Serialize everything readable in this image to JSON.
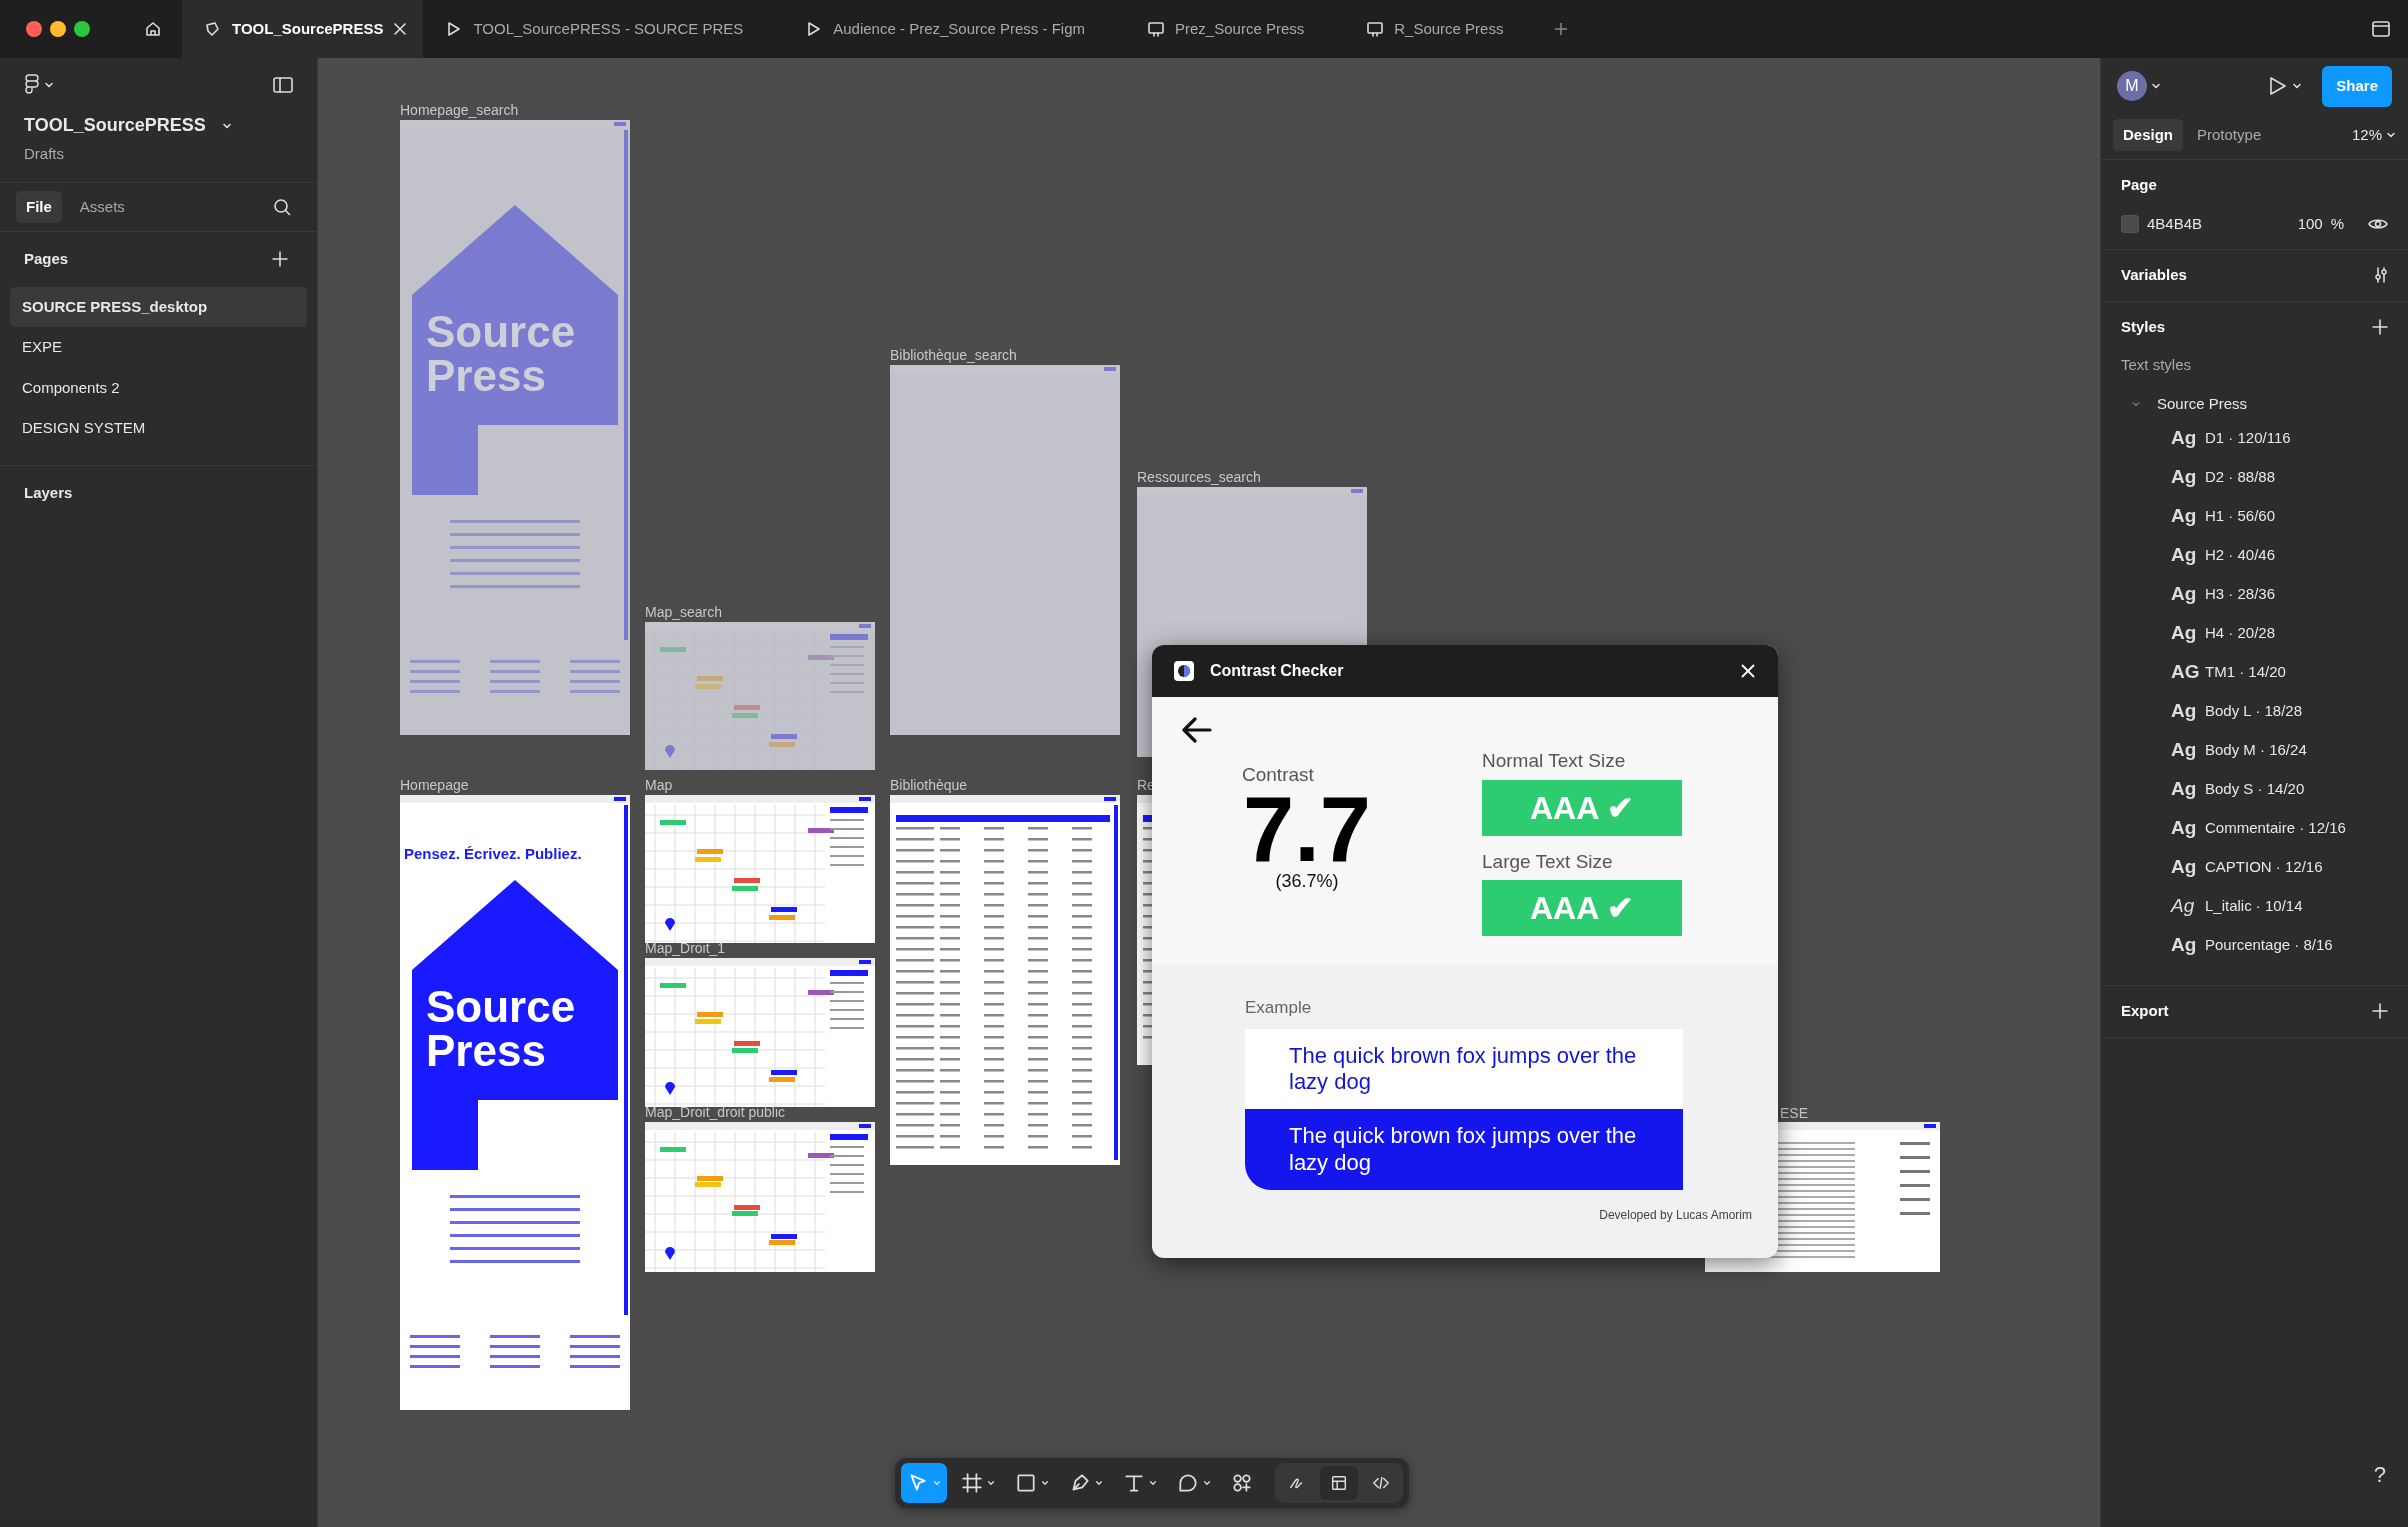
{
  "browser_tabs": [
    {
      "label": "TOOL_SourcePRESS",
      "kind": "design",
      "selected": true
    },
    {
      "label": "TOOL_SourcePRESS - SOURCE PRES",
      "kind": "prototype",
      "selected": false
    },
    {
      "label": "Audience - Prez_Source Press - Figm",
      "kind": "prototype",
      "selected": false
    },
    {
      "label": "Prez_Source Press",
      "kind": "slides",
      "selected": false
    },
    {
      "label": "R_Source Press",
      "kind": "slides",
      "selected": false
    }
  ],
  "sidebar": {
    "file_name": "TOOL_SourcePRESS",
    "location": "Drafts",
    "tabs": [
      {
        "label": "File",
        "selected": true
      },
      {
        "label": "Assets",
        "selected": false
      }
    ],
    "pages_heading": "Pages",
    "pages": [
      {
        "label": "SOURCE PRESS_desktop",
        "selected": true
      },
      {
        "label": "EXPE",
        "selected": false
      },
      {
        "label": "Components 2",
        "selected": false
      },
      {
        "label": "DESIGN SYSTEM",
        "selected": false
      }
    ],
    "layers_heading": "Layers"
  },
  "canvas": {
    "frames": [
      {
        "label": "Homepage_search",
        "kind": "home",
        "dimmed": true,
        "title": "Source Press"
      },
      {
        "label": "Map_search",
        "kind": "map",
        "dimmed": true
      },
      {
        "label": "Bibliothèque_search",
        "kind": "blank",
        "dimmed": true
      },
      {
        "label": "Ressources_search",
        "kind": "blank",
        "dimmed": true
      },
      {
        "label": "Homepage",
        "kind": "home",
        "dimmed": false,
        "headline": "Pensez. Écrivez. Publiez.",
        "title": "Source Press"
      },
      {
        "label": "Map",
        "kind": "map",
        "dimmed": false
      },
      {
        "label": "Map_Droit_1",
        "kind": "map",
        "dimmed": false
      },
      {
        "label": "Map_Droit_droit public",
        "kind": "map",
        "dimmed": false
      },
      {
        "label": "Bibliothèque",
        "kind": "table",
        "dimmed": false
      },
      {
        "label": "Re",
        "kind": "table",
        "dimmed": false
      },
      {
        "label": "ESE",
        "kind": "article",
        "dimmed": false
      }
    ]
  },
  "plugin": {
    "title": "Contrast Checker",
    "contrast_label": "Contrast",
    "ratio": "7.7",
    "percent": "(36.7%)",
    "results": [
      {
        "label": "Normal Text Size",
        "grade": "AAA ✔",
        "pass": true
      },
      {
        "label": "Large Text Size",
        "grade": "AAA ✔",
        "pass": true
      }
    ],
    "example_label": "Example",
    "examples": [
      {
        "text": "The quick brown fox jumps over the lazy dog",
        "kind": "light"
      },
      {
        "text": "The quick brown fox jumps over the lazy dog",
        "kind": "dark"
      }
    ],
    "credit": "Developed by Lucas Amorim"
  },
  "toolbar": {
    "tools": [
      {
        "kind": "move",
        "selected": true
      },
      {
        "kind": "frame",
        "selected": false
      },
      {
        "kind": "rectangle",
        "selected": false
      },
      {
        "kind": "pen",
        "selected": false
      },
      {
        "kind": "text",
        "selected": false
      },
      {
        "kind": "comment",
        "selected": false
      },
      {
        "kind": "actions",
        "selected": false
      }
    ],
    "modes": [
      {
        "kind": "draw",
        "selected": false
      },
      {
        "kind": "design",
        "selected": true
      },
      {
        "kind": "dev",
        "selected": false
      }
    ]
  },
  "right_panel": {
    "avatar": "M",
    "share": "Share",
    "tabs": [
      {
        "label": "Design",
        "selected": true
      },
      {
        "label": "Prototype",
        "selected": false
      }
    ],
    "zoom": "12%",
    "page_heading": "Page",
    "page_color": "4B4B4B",
    "page_opacity": "100",
    "opacity_unit": "%",
    "variables_heading": "Variables",
    "styles_heading": "Styles",
    "text_styles_heading": "Text styles",
    "style_group": "Source Press",
    "text_styles": [
      {
        "sample": "Ag",
        "label": "D1 · 120/116",
        "italic": false
      },
      {
        "sample": "Ag",
        "label": "D2 · 88/88",
        "italic": false
      },
      {
        "sample": "Ag",
        "label": "H1 · 56/60",
        "italic": false
      },
      {
        "sample": "Ag",
        "label": "H2 · 40/46",
        "italic": false
      },
      {
        "sample": "Ag",
        "label": "H3 · 28/36",
        "italic": false
      },
      {
        "sample": "Ag",
        "label": "H4 · 20/28",
        "italic": false
      },
      {
        "sample": "AG",
        "label": "TM1 · 14/20",
        "italic": false
      },
      {
        "sample": "Ag",
        "label": "Body L · 18/28",
        "italic": false
      },
      {
        "sample": "Ag",
        "label": "Body M · 16/24",
        "italic": false
      },
      {
        "sample": "Ag",
        "label": "Body S · 14/20",
        "italic": false
      },
      {
        "sample": "Ag",
        "label": "Commentaire · 12/16",
        "italic": false
      },
      {
        "sample": "Ag",
        "label": "CAPTION · 12/16",
        "italic": false
      },
      {
        "sample": "Ag",
        "label": "L_italic · 10/14",
        "italic": true
      },
      {
        "sample": "Ag",
        "label": "Pourcentage · 8/16",
        "italic": false
      }
    ],
    "export_heading": "Export",
    "help": "?"
  }
}
